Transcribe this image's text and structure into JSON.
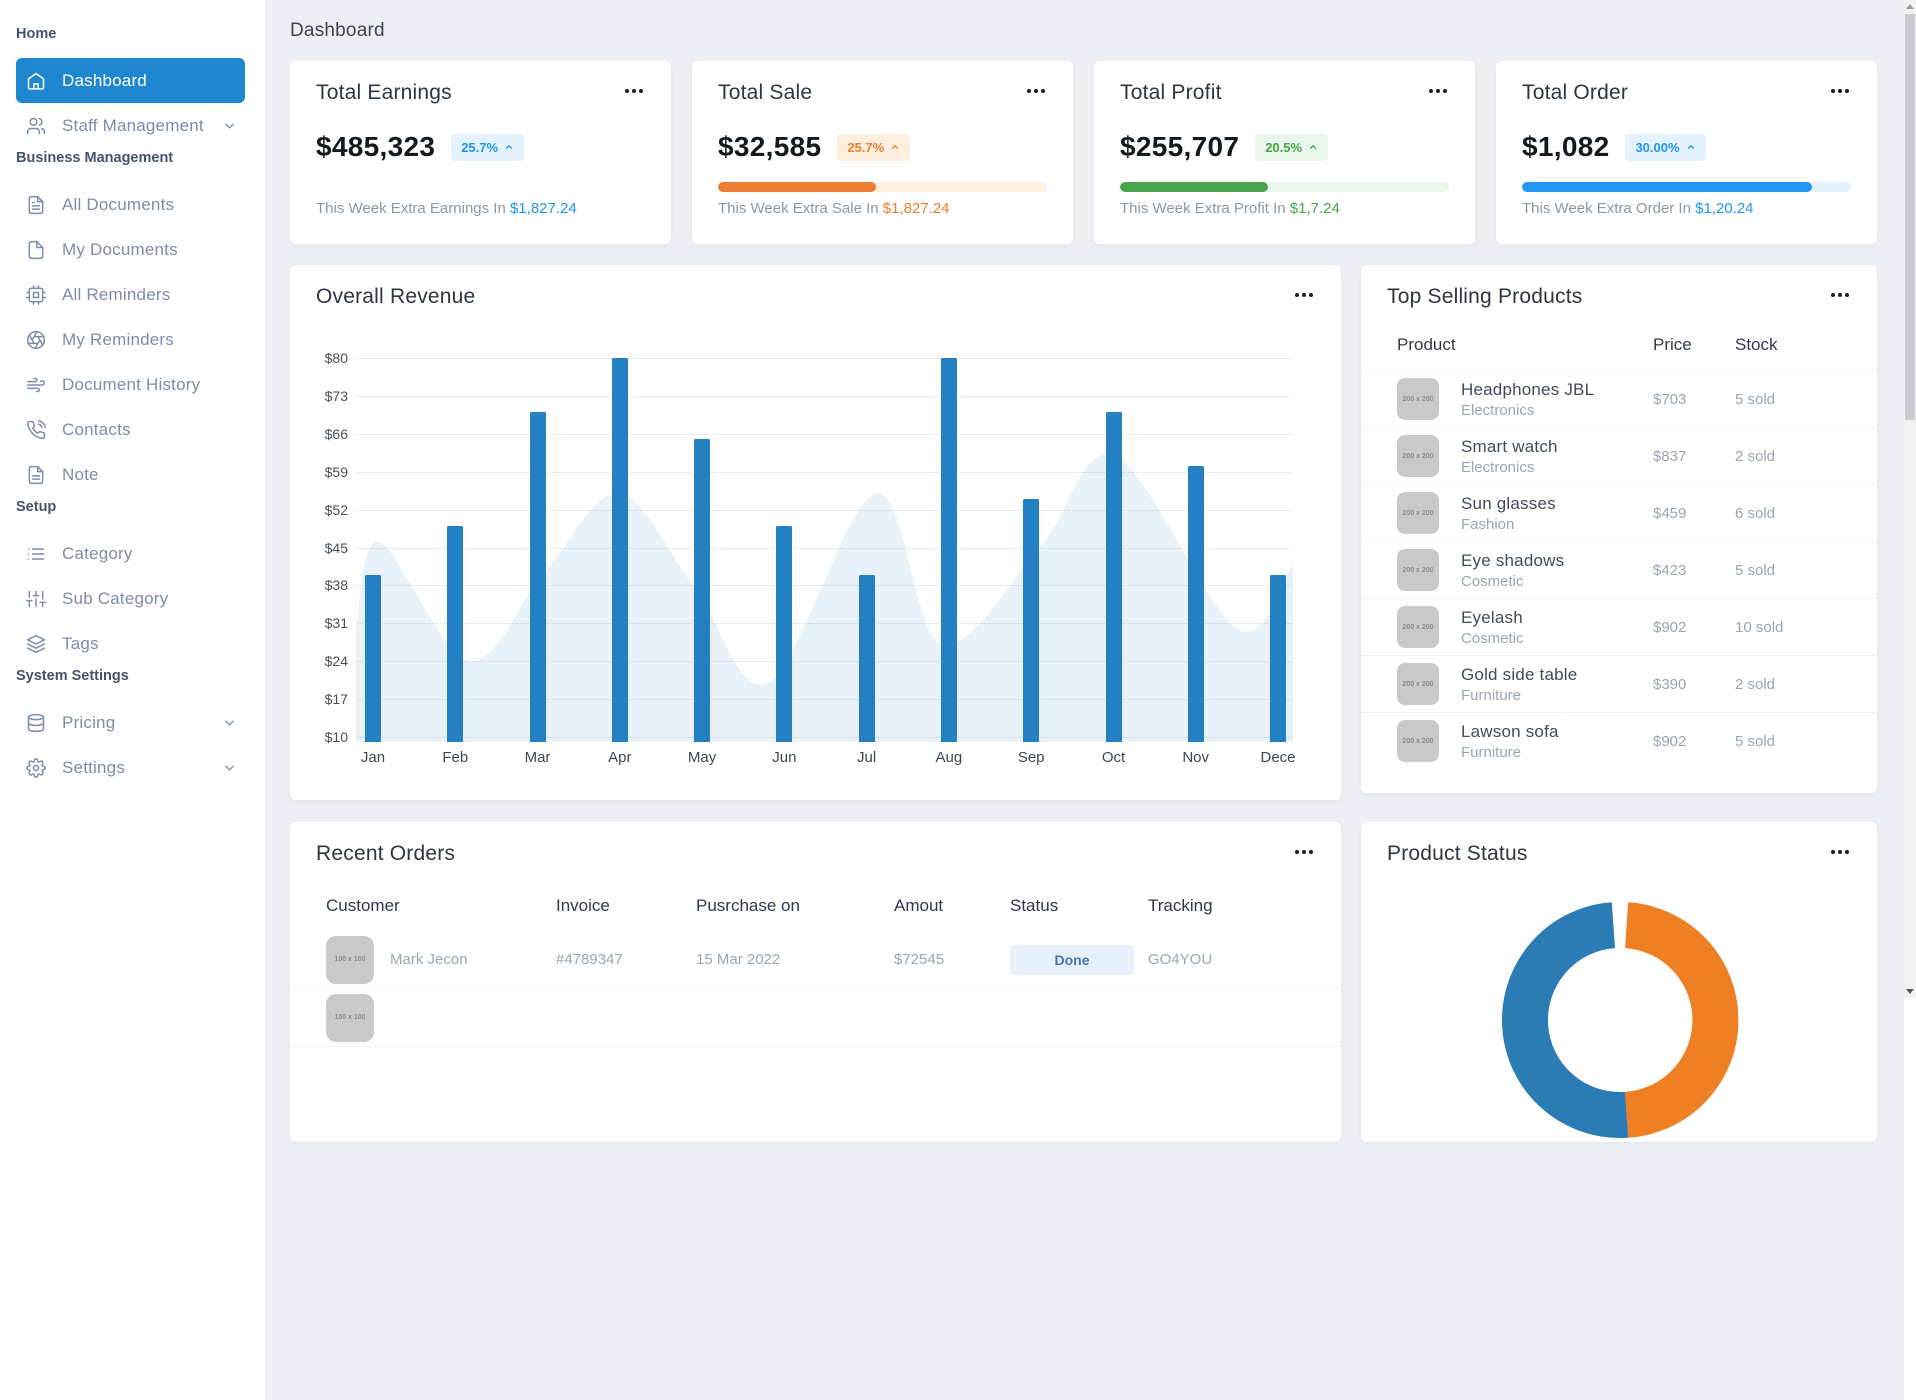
{
  "header": {
    "title": "Dashboard"
  },
  "sidebar": {
    "sections": [
      {
        "label": "Home",
        "items": [
          {
            "slug": "dashboard",
            "icon": "home-icon",
            "label": "Dashboard",
            "active": true
          },
          {
            "slug": "staff-management",
            "icon": "users-icon",
            "label": "Staff Management",
            "chevron": true
          }
        ]
      },
      {
        "label": "Business Management",
        "items": [
          {
            "slug": "all-documents",
            "icon": "file-text-icon",
            "label": "All Documents"
          },
          {
            "slug": "my-documents",
            "icon": "file-icon",
            "label": "My Documents"
          },
          {
            "slug": "all-reminders",
            "icon": "cpu-icon",
            "label": "All Reminders"
          },
          {
            "slug": "my-reminders",
            "icon": "aperture-icon",
            "label": "My Reminders"
          },
          {
            "slug": "document-history",
            "icon": "wind-icon",
            "label": "Document History"
          },
          {
            "slug": "contacts",
            "icon": "phone-icon",
            "label": "Contacts"
          },
          {
            "slug": "note",
            "icon": "note-icon",
            "label": "Note"
          }
        ]
      },
      {
        "label": "Setup",
        "items": [
          {
            "slug": "category",
            "icon": "list-icon",
            "label": "Category"
          },
          {
            "slug": "sub-category",
            "icon": "sliders-icon",
            "label": "Sub Category"
          },
          {
            "slug": "tags",
            "icon": "layers-icon",
            "label": "Tags"
          }
        ]
      },
      {
        "label": "System Settings",
        "items": [
          {
            "slug": "pricing",
            "icon": "database-icon",
            "label": "Pricing",
            "chevron": true
          },
          {
            "slug": "settings",
            "icon": "gear-icon",
            "label": "Settings",
            "chevron": true
          }
        ]
      }
    ]
  },
  "stat_cards": [
    {
      "title": "Total Earnings",
      "value": "$485,323",
      "badge": "25.7%",
      "accent": "#2196f3",
      "badge_bg": "#e3f2fd",
      "subtitle_prefix": "This Week Extra Earnings In ",
      "subtitle_amount": "$1,827.24",
      "progress": null,
      "track": null
    },
    {
      "title": "Total Sale",
      "value": "$32,585",
      "badge": "25.7%",
      "accent": "#ed7d31",
      "badge_bg": "#fdeede",
      "subtitle_prefix": "This Week Extra Sale In ",
      "subtitle_amount": "$1,827.24",
      "progress": 48,
      "track": "#fdeede"
    },
    {
      "title": "Total Profit",
      "value": "$255,707",
      "badge": "20.5%",
      "accent": "#47a44b",
      "badge_bg": "#eaf5ec",
      "subtitle_prefix": "This Week Extra Profit In ",
      "subtitle_amount": "$1,7.24",
      "progress": 45,
      "track": "#eaf5ec"
    },
    {
      "title": "Total Order",
      "value": "$1,082",
      "badge": "30.00%",
      "accent": "#2196f3",
      "badge_bg": "#e3f2fd",
      "subtitle_prefix": "This Week Extra Order In ",
      "subtitle_amount": "$1,20.24",
      "progress": 88,
      "track": "#e3f2fd"
    }
  ],
  "chart_data": {
    "type": "bar",
    "title": "Overall Revenue",
    "categories": [
      "Jan",
      "Feb",
      "Mar",
      "Apr",
      "May",
      "Jun",
      "Jul",
      "Aug",
      "Sep",
      "Oct",
      "Nov",
      "Dece"
    ],
    "series": [
      {
        "name": "Revenue bars",
        "type": "bar",
        "values": [
          40,
          49,
          70,
          80,
          65,
          49,
          40,
          80,
          54,
          70,
          60,
          40
        ]
      },
      {
        "name": "Background trend area",
        "type": "area",
        "points": [
          [
            0,
            30
          ],
          [
            0.025,
            46
          ],
          [
            0.12,
            24
          ],
          [
            0.2,
            40
          ],
          [
            0.28,
            55
          ],
          [
            0.36,
            38
          ],
          [
            0.44,
            20
          ],
          [
            0.555,
            55
          ],
          [
            0.625,
            27
          ],
          [
            0.73,
            45
          ],
          [
            0.81,
            62
          ],
          [
            0.94,
            30
          ],
          [
            1,
            42
          ]
        ]
      }
    ],
    "ytick_labels": [
      "$80",
      "$73",
      "$66",
      "$59",
      "$52",
      "$45",
      "$38",
      "$31",
      "$24",
      "$17",
      "$10"
    ],
    "ytick_values": [
      80,
      73,
      66,
      59,
      52,
      45,
      38,
      31,
      24,
      17,
      10
    ],
    "ylim": [
      10,
      80
    ],
    "xlabel": "",
    "ylabel": "",
    "grid": "horizontal-dotted",
    "legend": "none",
    "bar_color": "#2380c3",
    "area_color": "rgba(35,128,195,0.10)"
  },
  "top_products": {
    "title": "Top Selling Products",
    "columns": [
      "Product",
      "Price",
      "Stock"
    ],
    "thumb_label": "200 x 200",
    "rows": [
      {
        "name": "Headphones JBL",
        "category": "Electronics",
        "price": "$703",
        "stock": "5 sold"
      },
      {
        "name": "Smart watch",
        "category": "Electronics",
        "price": "$837",
        "stock": "2 sold"
      },
      {
        "name": "Sun glasses",
        "category": "Fashion",
        "price": "$459",
        "stock": "6 sold"
      },
      {
        "name": "Eye shadows",
        "category": "Cosmetic",
        "price": "$423",
        "stock": "5 sold"
      },
      {
        "name": "Eyelash",
        "category": "Cosmetic",
        "price": "$902",
        "stock": "10 sold"
      },
      {
        "name": "Gold side table",
        "category": "Furniture",
        "price": "$390",
        "stock": "2 sold"
      },
      {
        "name": "Lawson sofa",
        "category": "Furniture",
        "price": "$902",
        "stock": "5 sold"
      }
    ]
  },
  "recent_orders": {
    "title": "Recent Orders",
    "columns": [
      "Customer",
      "Invoice",
      "Pusrchase on",
      "Amout",
      "Status",
      "Tracking"
    ],
    "avatar_label": "100 x 100",
    "rows": [
      {
        "customer": "Mark Jecon",
        "invoice": "#4789347",
        "date": "15 Mar 2022",
        "amount": "$72545",
        "status": "Done",
        "tracking": "GO4YOU"
      },
      {
        "customer": "",
        "invoice": "",
        "date": "",
        "amount": "",
        "status": "",
        "tracking": "",
        "partial": true
      }
    ]
  },
  "product_status": {
    "title": "Product Status",
    "donut": {
      "segments": [
        {
          "label": "segment-orange",
          "color": "#ee7f22",
          "start_deg": 4,
          "end_deg": 176
        },
        {
          "label": "segment-blue",
          "color": "#2b7cb5",
          "start_deg": 176,
          "end_deg": 356
        }
      ]
    }
  }
}
